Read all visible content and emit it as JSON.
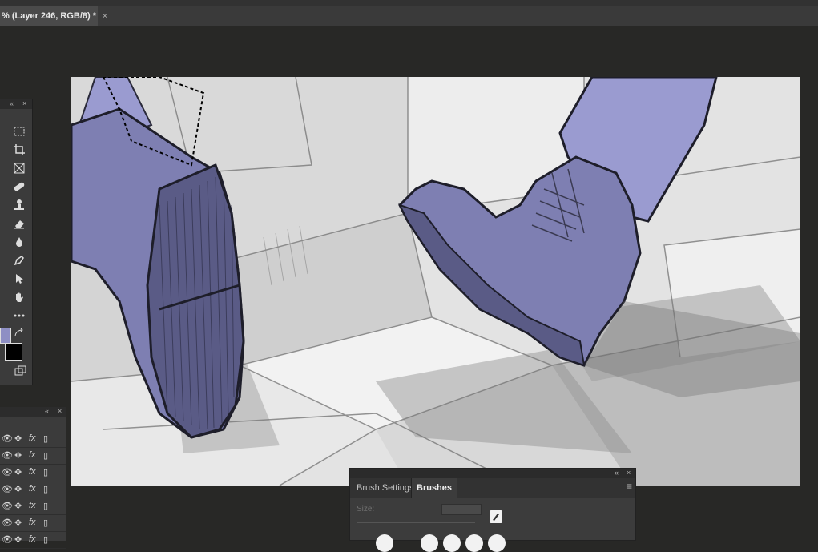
{
  "document": {
    "tab_title": "% (Layer 246, RGB/8) *",
    "close_symbol": "×"
  },
  "panels": {
    "collapse_symbol": "«",
    "close_symbol": "×",
    "menu_symbol": "≡"
  },
  "tools": [
    {
      "name": "marquee-tool",
      "icon": "rect-marquee-icon"
    },
    {
      "name": "crop-tool",
      "icon": "crop-icon"
    },
    {
      "name": "frame-tool",
      "icon": "frame-icon"
    },
    {
      "name": "healing-brush-tool",
      "icon": "bandage-icon"
    },
    {
      "name": "stamp-tool",
      "icon": "stamp-icon"
    },
    {
      "name": "eraser-tool",
      "icon": "eraser-icon"
    },
    {
      "name": "blur-tool",
      "icon": "drop-icon"
    },
    {
      "name": "pen-tool",
      "icon": "pen-icon"
    },
    {
      "name": "path-selection-tool",
      "icon": "arrow-icon"
    },
    {
      "name": "hand-tool",
      "icon": "hand-icon"
    },
    {
      "name": "more-tools",
      "icon": "ellipsis-icon"
    }
  ],
  "colors": {
    "foreground": "#8e8fc4",
    "background": "#000000",
    "canvas_sketch": "#e6e6e6",
    "pants": "#9696c8",
    "boots": "#6f6f9c"
  },
  "layers": {
    "row_icons": [
      "eye-icon",
      "move-icon",
      "fx-icon",
      "lock-icon"
    ],
    "fx_label": "fx",
    "row_count": 7
  },
  "brush_panel": {
    "tab_settings": "Brush Settings",
    "tab_brushes": "Brushes",
    "size_label": "Size:"
  }
}
